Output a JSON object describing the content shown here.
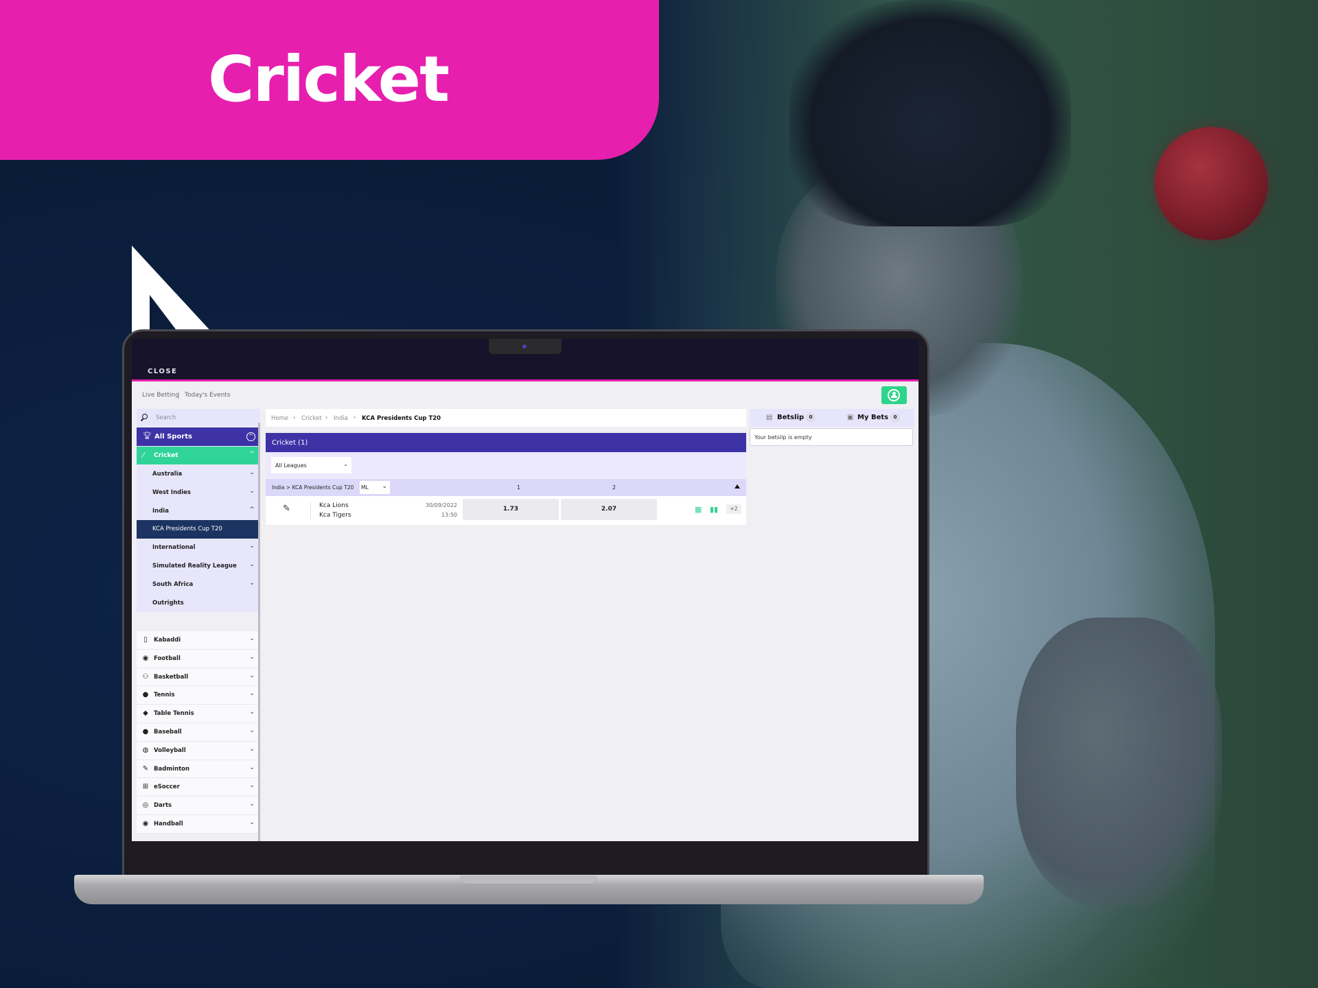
{
  "banner": {
    "title": "Cricket",
    "color": "#e61fae"
  },
  "topbar": {
    "close_label": "CLOSE",
    "accent": "#e61fae"
  },
  "subnav": {
    "live_betting": "Live Betting",
    "todays_events": "Today's Events"
  },
  "account_button": {
    "icon": "user-circle-icon",
    "color": "#2ed48a"
  },
  "sidebar": {
    "search_placeholder": "Search",
    "all_sports_label": "All Sports",
    "active_sport": {
      "label": "Cricket",
      "icon": "cricket-bat-icon",
      "color": "#30d49b"
    },
    "sub_items": [
      {
        "label": "Australia",
        "chevron": "down"
      },
      {
        "label": "West Indies",
        "chevron": "down"
      },
      {
        "label": "India",
        "chevron": "up"
      },
      {
        "label": "KCA Presidents Cup T20",
        "chevron": "",
        "active": true
      },
      {
        "label": "International",
        "chevron": "down"
      },
      {
        "label": "Simulated Reality League",
        "chevron": "down"
      },
      {
        "label": "South Africa",
        "chevron": "down"
      },
      {
        "label": "Outrights",
        "chevron": ""
      }
    ],
    "sports": [
      {
        "label": "Kabaddi",
        "icon": "kabaddi-icon",
        "glyph": "▯"
      },
      {
        "label": "Football",
        "icon": "football-icon",
        "glyph": "◉"
      },
      {
        "label": "Basketball",
        "icon": "basketball-icon",
        "glyph": "⚇"
      },
      {
        "label": "Tennis",
        "icon": "tennis-icon",
        "glyph": "●"
      },
      {
        "label": "Table Tennis",
        "icon": "table-tennis-icon",
        "glyph": "◆"
      },
      {
        "label": "Baseball",
        "icon": "baseball-icon",
        "glyph": "●"
      },
      {
        "label": "Volleyball",
        "icon": "volleyball-icon",
        "glyph": "◍"
      },
      {
        "label": "Badminton",
        "icon": "badminton-icon",
        "glyph": "✎"
      },
      {
        "label": "eSoccer",
        "icon": "gamepad-icon",
        "glyph": "⊞"
      },
      {
        "label": "Darts",
        "icon": "darts-icon",
        "glyph": "◎"
      },
      {
        "label": "Handball",
        "icon": "handball-icon",
        "glyph": "◉"
      }
    ]
  },
  "main": {
    "breadcrumb": [
      "Home",
      "Cricket",
      "India",
      "KCA Presidents Cup T20"
    ],
    "section_title": "Cricket (1)",
    "league_filter": "All Leagues",
    "table": {
      "crumb": "India > KCA Presidents Cup T20",
      "market": "ML",
      "columns": [
        "1",
        "2"
      ]
    },
    "events": [
      {
        "home": "Kca Lions",
        "away": "Kca Tigers",
        "date": "30/09/2022",
        "time": "13:50",
        "odds": [
          "1.73",
          "2.07"
        ],
        "more_markets": "+2"
      }
    ]
  },
  "betslip": {
    "tab_betslip": "Betslip",
    "betslip_count": "0",
    "tab_mybets": "My Bets",
    "mybets_count": "0",
    "empty_message": "Your betslip is empty"
  }
}
